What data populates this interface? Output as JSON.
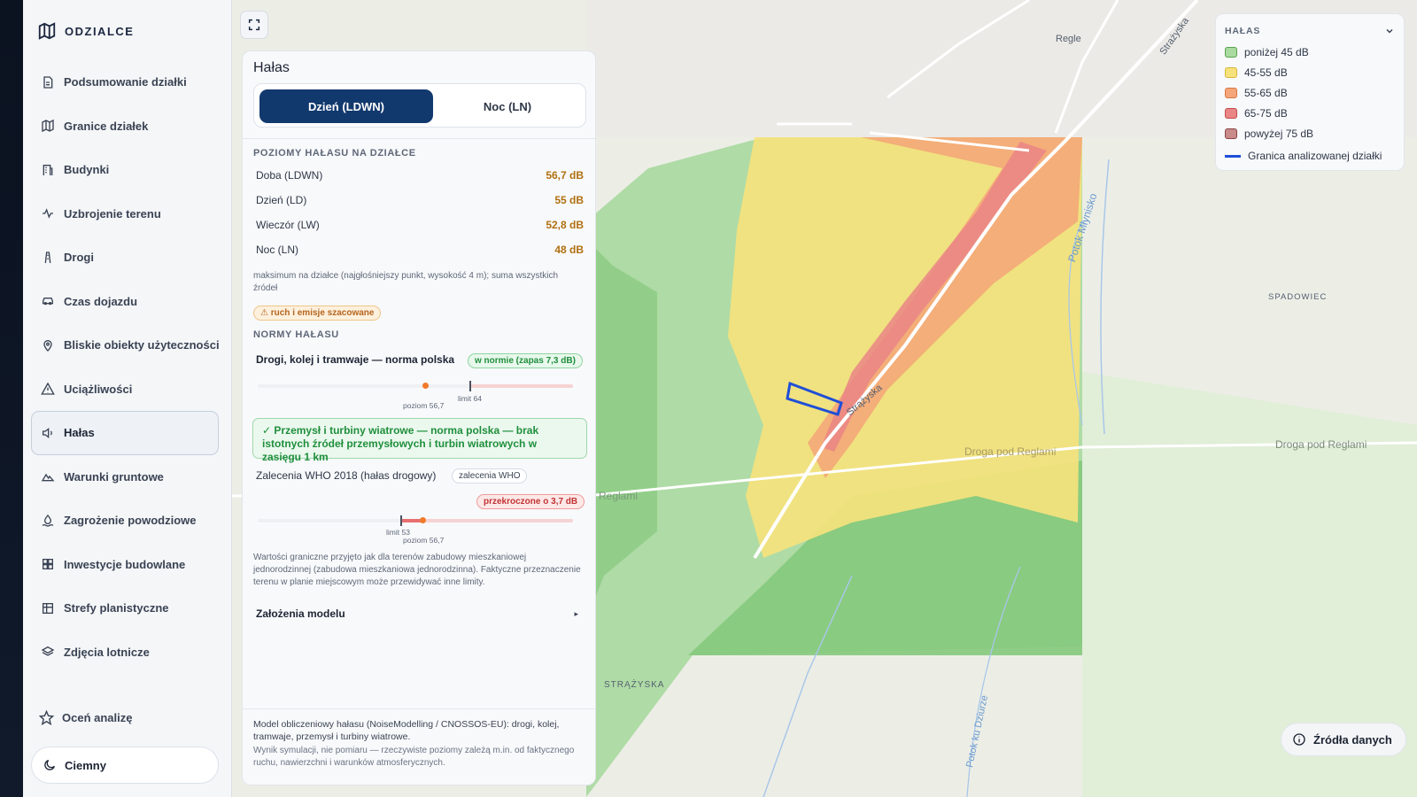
{
  "brand": {
    "name": "ODZIALCE"
  },
  "nav": [
    {
      "label": "Podsumowanie działki",
      "icon": "document-icon"
    },
    {
      "label": "Granice działek",
      "icon": "map-icon"
    },
    {
      "label": "Budynki",
      "icon": "building-icon"
    },
    {
      "label": "Uzbrojenie terenu",
      "icon": "utility-icon"
    },
    {
      "label": "Drogi",
      "icon": "road-icon"
    },
    {
      "label": "Czas dojazdu",
      "icon": "car-icon"
    },
    {
      "label": "Bliskie obiekty użyteczności",
      "icon": "pin-icon"
    },
    {
      "label": "Uciążliwości",
      "icon": "warning-icon"
    },
    {
      "label": "Hałas",
      "icon": "speaker-icon",
      "active": true
    },
    {
      "label": "Warunki gruntowe",
      "icon": "mountain-icon"
    },
    {
      "label": "Zagrożenie powodziowe",
      "icon": "flood-icon"
    },
    {
      "label": "Inwestycje budowlane",
      "icon": "grid-icon"
    },
    {
      "label": "Strefy planistyczne",
      "icon": "table-icon"
    },
    {
      "label": "Zdjęcia lotnicze",
      "icon": "layers-icon"
    }
  ],
  "rate": {
    "label": "Oceń analizę"
  },
  "theme": {
    "label": "Ciemny"
  },
  "panel": {
    "title": "Hałas",
    "tab_day": "Dzień (LDWN)",
    "tab_night": "Noc (LN)",
    "levels_heading": "POZIOMY HAŁASU NA DZIAŁCE",
    "levels": [
      {
        "label": "Doba (LDWN)",
        "value": "56,7 dB"
      },
      {
        "label": "Dzień (LD)",
        "value": "55 dB"
      },
      {
        "label": "Wieczór (LW)",
        "value": "52,8 dB"
      },
      {
        "label": "Noc (LN)",
        "value": "48 dB"
      }
    ],
    "levels_note": "maksimum na działce (najgłośniejszy punkt, wysokość 4 m); suma wszystkich źródeł",
    "estimate_badge": "⚠ ruch i emisje szacowane",
    "norms_heading": "NORMY HAŁASU",
    "norm1": {
      "title": "Drogi, kolej i tramwaje — norma polska",
      "badge": "w normie (zapas 7,3 dB)",
      "level_label": "poziom 56,7",
      "limit_label": "limit 64"
    },
    "industry_note": "✓ Przemysł i turbiny wiatrowe — norma polska — brak istotnych źródeł przemysłowych i turbin wiatrowych w zasięgu 1 km",
    "who": {
      "title": "Zalecenia WHO 2018 (hałas drogowy)",
      "tag": "zalecenia WHO",
      "badge": "przekroczone o 3,7 dB",
      "limit_label": "limit 53",
      "level_label": "poziom 56,7"
    },
    "limits_note": "Wartości graniczne przyjęto jak dla terenów zabudowy mieszkaniowej jednorodzinnej (zabudowa mieszkaniowa jednorodzinna). Faktyczne przeznaczenie terenu w planie miejscowym może przewidywać inne limity.",
    "model_label": "Założenia modelu",
    "model_caret": "▸",
    "footer_1": "Model obliczeniowy hałasu (NoiseModelling / CNOSSOS-EU): drogi, kolej, tramwaje, przemysł i turbiny wiatrowe.",
    "footer_2": "Wynik symulacji, nie pomiaru — rzeczywiste poziomy zależą m.in. od faktycznego ruchu, nawierzchni i warunków atmosferycznych."
  },
  "legend": {
    "title": "HAŁAS",
    "items": [
      {
        "label": "poniżej 45 dB",
        "fill": "#a9dba0",
        "stroke": "#5aa24f"
      },
      {
        "label": "45-55 dB",
        "fill": "#f6e27a",
        "stroke": "#d6b43a"
      },
      {
        "label": "55-65 dB",
        "fill": "#f4a67a",
        "stroke": "#d9773f"
      },
      {
        "label": "65-75 dB",
        "fill": "#ea8585",
        "stroke": "#c44a4a"
      },
      {
        "label": "powyżej 75 dB",
        "fill": "#c98a8a",
        "stroke": "#8a4545"
      }
    ],
    "boundary_label": "Granica analizowanej działki",
    "boundary_color": "#1f4fd8"
  },
  "map_labels": {
    "regle": "Regle",
    "strazyska_n": "Strażyska",
    "potok_mlynisko": "Potok Młynisko",
    "spadowiec": "SPADOWIEC",
    "strazyska_road": "Strążyska",
    "droga1": "Droga pod Reglami",
    "droga2": "Droga pod Reglami",
    "reglami_w": "Reglami",
    "strazyska_s": "STRĄŻYSKA",
    "potok_dzianiec": "Potok ku Dziurze"
  },
  "sources": {
    "label": "Źródła danych"
  }
}
